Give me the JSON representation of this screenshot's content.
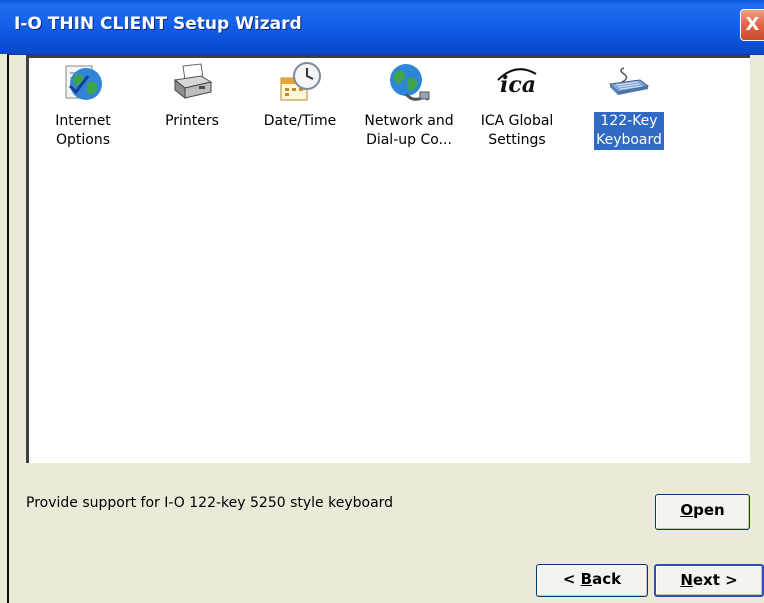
{
  "window": {
    "title": "I-O THIN CLIENT Setup Wizard",
    "close_glyph": "X"
  },
  "applets": [
    {
      "label": "Internet\nOptions",
      "icon": "internet-options-icon",
      "selected": false
    },
    {
      "label": "Printers",
      "icon": "printer-icon",
      "selected": false
    },
    {
      "label": "Date/Time",
      "icon": "date-time-icon",
      "selected": false
    },
    {
      "label": "Network and\nDial-up Co...",
      "icon": "network-globe-icon",
      "selected": false
    },
    {
      "label": "ICA Global\nSettings",
      "icon": "ica-icon",
      "selected": false
    },
    {
      "label": "122-Key\nKeyboard",
      "icon": "keyboard-icon",
      "selected": true
    }
  ],
  "description": "Provide support for I-O 122-key 5250 style keyboard",
  "buttons": {
    "open": {
      "accel": "O",
      "rest": "pen"
    },
    "back": {
      "prefix": "< ",
      "accel": "B",
      "rest": "ack"
    },
    "next": {
      "accel": "N",
      "rest": "ext >"
    }
  },
  "colors": {
    "titlebar": "#0A56E0",
    "window_face": "#ECE9D8",
    "selection": "#316AC5"
  }
}
